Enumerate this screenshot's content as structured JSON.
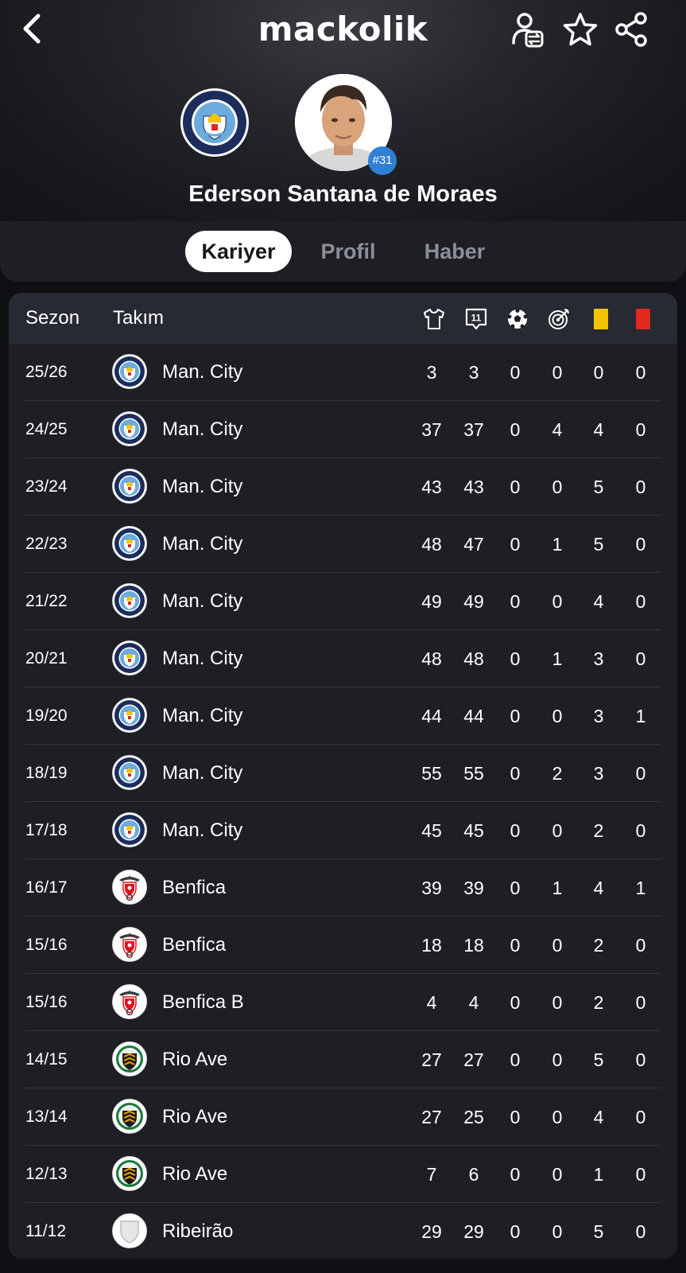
{
  "app": {
    "logo": "mackolik"
  },
  "player": {
    "name": "Ederson Santana de Moraes",
    "shirt_number": "#31"
  },
  "tabs": [
    {
      "label": "Kariyer",
      "active": true
    },
    {
      "label": "Profil",
      "active": false
    },
    {
      "label": "Haber",
      "active": false
    }
  ],
  "table": {
    "headers": {
      "season": "Sezon",
      "team": "Takım"
    },
    "stat_icons": [
      "shirt-icon",
      "starting-eleven-icon",
      "football-icon",
      "target-icon",
      "yellow-card-icon",
      "red-card-icon"
    ],
    "colors": {
      "yellow_card": "#f5c400",
      "red_card": "#e0281e",
      "city_blue": "#6cabdd",
      "benfica_red": "#e3101a",
      "rio_ave_green": "#1a7a3c"
    },
    "rows": [
      {
        "season": "25/26",
        "team": "Man. City",
        "crest": "man-city",
        "stats": [
          "3",
          "3",
          "0",
          "0",
          "0",
          "0"
        ]
      },
      {
        "season": "24/25",
        "team": "Man. City",
        "crest": "man-city",
        "stats": [
          "37",
          "37",
          "0",
          "4",
          "4",
          "0"
        ]
      },
      {
        "season": "23/24",
        "team": "Man. City",
        "crest": "man-city",
        "stats": [
          "43",
          "43",
          "0",
          "0",
          "5",
          "0"
        ]
      },
      {
        "season": "22/23",
        "team": "Man. City",
        "crest": "man-city",
        "stats": [
          "48",
          "47",
          "0",
          "1",
          "5",
          "0"
        ]
      },
      {
        "season": "21/22",
        "team": "Man. City",
        "crest": "man-city",
        "stats": [
          "49",
          "49",
          "0",
          "0",
          "4",
          "0"
        ]
      },
      {
        "season": "20/21",
        "team": "Man. City",
        "crest": "man-city",
        "stats": [
          "48",
          "48",
          "0",
          "1",
          "3",
          "0"
        ]
      },
      {
        "season": "19/20",
        "team": "Man. City",
        "crest": "man-city",
        "stats": [
          "44",
          "44",
          "0",
          "0",
          "3",
          "1"
        ]
      },
      {
        "season": "18/19",
        "team": "Man. City",
        "crest": "man-city",
        "stats": [
          "55",
          "55",
          "0",
          "2",
          "3",
          "0"
        ]
      },
      {
        "season": "17/18",
        "team": "Man. City",
        "crest": "man-city",
        "stats": [
          "45",
          "45",
          "0",
          "0",
          "2",
          "0"
        ]
      },
      {
        "season": "16/17",
        "team": "Benfica",
        "crest": "benfica",
        "stats": [
          "39",
          "39",
          "0",
          "1",
          "4",
          "1"
        ]
      },
      {
        "season": "15/16",
        "team": "Benfica",
        "crest": "benfica",
        "stats": [
          "18",
          "18",
          "0",
          "0",
          "2",
          "0"
        ]
      },
      {
        "season": "15/16",
        "team": "Benfica B",
        "crest": "benfica",
        "stats": [
          "4",
          "4",
          "0",
          "0",
          "2",
          "0"
        ]
      },
      {
        "season": "14/15",
        "team": "Rio Ave",
        "crest": "rio-ave",
        "stats": [
          "27",
          "27",
          "0",
          "0",
          "5",
          "0"
        ]
      },
      {
        "season": "13/14",
        "team": "Rio Ave",
        "crest": "rio-ave",
        "stats": [
          "27",
          "25",
          "0",
          "0",
          "4",
          "0"
        ]
      },
      {
        "season": "12/13",
        "team": "Rio Ave",
        "crest": "rio-ave",
        "stats": [
          "7",
          "6",
          "0",
          "0",
          "1",
          "0"
        ]
      },
      {
        "season": "11/12",
        "team": "Ribeirão",
        "crest": "ribeirao",
        "stats": [
          "29",
          "29",
          "0",
          "0",
          "5",
          "0"
        ]
      }
    ]
  }
}
